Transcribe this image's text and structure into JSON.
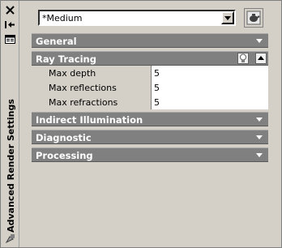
{
  "palette": {
    "title": "Advanced Render Settings"
  },
  "preset": {
    "value": "*Medium"
  },
  "sections": {
    "general": "General",
    "ray_tracing": "Ray Tracing",
    "indirect": "Indirect Illumination",
    "diagnostic": "Diagnostic",
    "processing": "Processing"
  },
  "ray_tracing": {
    "rows": [
      {
        "label": "Max depth",
        "value": "5"
      },
      {
        "label": "Max reflections",
        "value": "5"
      },
      {
        "label": "Max refractions",
        "value": "5"
      }
    ]
  }
}
